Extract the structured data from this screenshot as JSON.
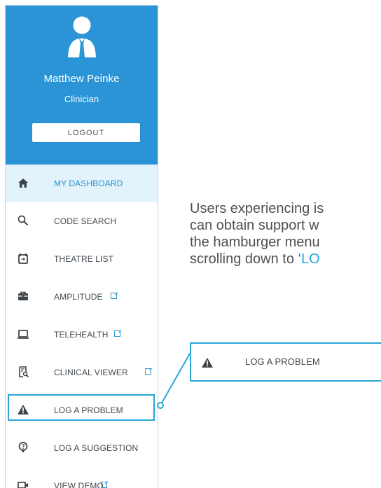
{
  "profile": {
    "name": "Matthew Peinke",
    "role": "Clinician",
    "logout_label": "LOGOUT",
    "background_color": "#2a94d6"
  },
  "sidebar": {
    "items": [
      {
        "label": "MY DASHBOARD",
        "icon": "home-icon",
        "active": true,
        "external": false
      },
      {
        "label": "CODE SEARCH",
        "icon": "search-icon",
        "active": false,
        "external": false
      },
      {
        "label": "THEATRE LIST",
        "icon": "calendar-icon",
        "active": false,
        "external": false
      },
      {
        "label": "AMPLITUDE",
        "icon": "briefcase-icon",
        "active": false,
        "external": true
      },
      {
        "label": "TELEHEALTH",
        "icon": "laptop-icon",
        "active": false,
        "external": true
      },
      {
        "label": "CLINICAL VIEWER",
        "icon": "document-search-icon",
        "active": false,
        "external": true
      },
      {
        "label": "LOG A PROBLEM",
        "icon": "warning-icon",
        "active": false,
        "external": false
      },
      {
        "label": "LOG A SUGGESTION",
        "icon": "lightbulb-icon",
        "active": false,
        "external": false
      },
      {
        "label": "VIEW DEMO",
        "icon": "video-camera-icon",
        "active": false,
        "external": true
      }
    ]
  },
  "content": {
    "instruction_lines": [
      "Users experiencing is",
      "can obtain support w",
      "the hamburger menu",
      "scrolling down to ‘"
    ],
    "instruction_link_text": "LO",
    "callout_label": "LOG A PROBLEM"
  },
  "colors": {
    "accent": "#2a94d6",
    "highlight": "#29a7d6",
    "active_background": "#e2f3fb",
    "text": "#434a51"
  }
}
